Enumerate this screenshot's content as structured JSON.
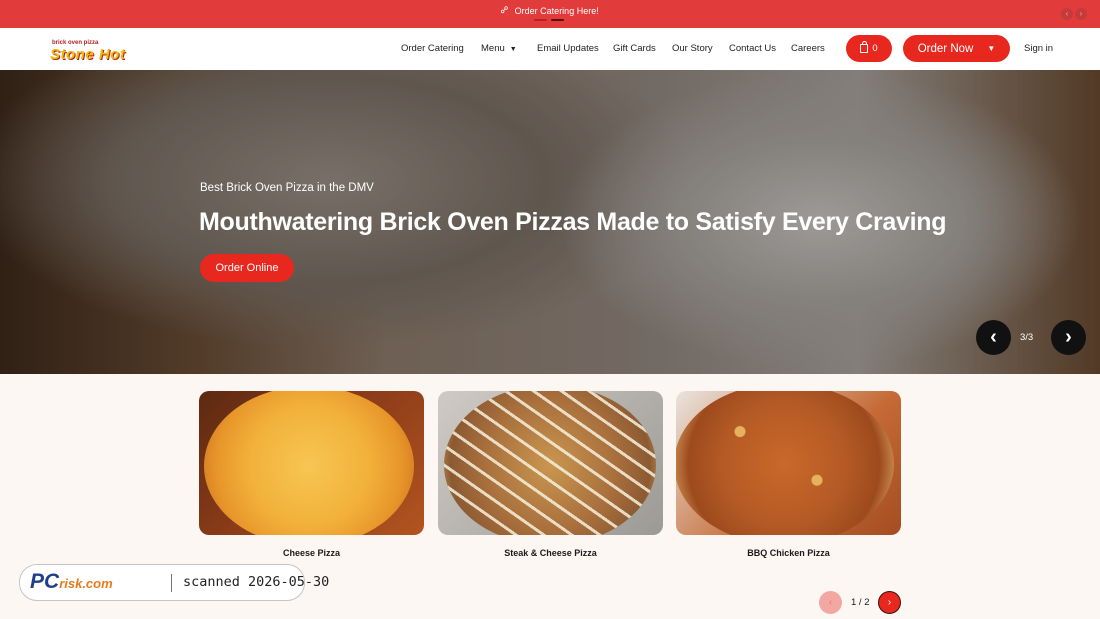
{
  "announcement": {
    "link_icon": "link-icon",
    "text": "Order Catering Here!",
    "prev_icon": "chevron-left-icon",
    "next_icon": "chevron-right-icon"
  },
  "header": {
    "logo": {
      "small": "brick oven pizza",
      "big": "Stone Hot"
    },
    "nav": [
      {
        "label": "Order Catering"
      },
      {
        "label": "Menu",
        "caret": "▼"
      },
      {
        "label": "Email Updates"
      },
      {
        "label": "Gift Cards"
      },
      {
        "label": "Our Story"
      },
      {
        "label": "Contact Us"
      },
      {
        "label": "Careers"
      }
    ],
    "cart": {
      "icon": "shopping-bag-icon",
      "count": "0"
    },
    "order_now": {
      "label": "Order Now",
      "caret": "▼"
    },
    "sign_in": "Sign in"
  },
  "hero": {
    "subtitle": "Best Brick Oven Pizza in the DMV",
    "title": "Mouthwatering Brick Oven Pizzas Made to Satisfy Every Craving",
    "cta": "Order Online",
    "prev_arrow": "‹",
    "next_arrow": "›",
    "slide_counter": "3/3"
  },
  "products": [
    {
      "name": "Cheese Pizza"
    },
    {
      "name": "Steak & Cheese Pizza"
    },
    {
      "name": "BBQ Chicken Pizza"
    }
  ],
  "pagination": {
    "prev": "‹",
    "next": "›",
    "counter": "1 / 2"
  },
  "watermark": {
    "brand": "PC",
    "brand_suffix": "risk.com",
    "text": "scanned 2026-05-30"
  },
  "colors": {
    "brand_red": "#e8281f",
    "announcement_bg": "#e23b3b",
    "page_bg": "#fdf7f4"
  }
}
